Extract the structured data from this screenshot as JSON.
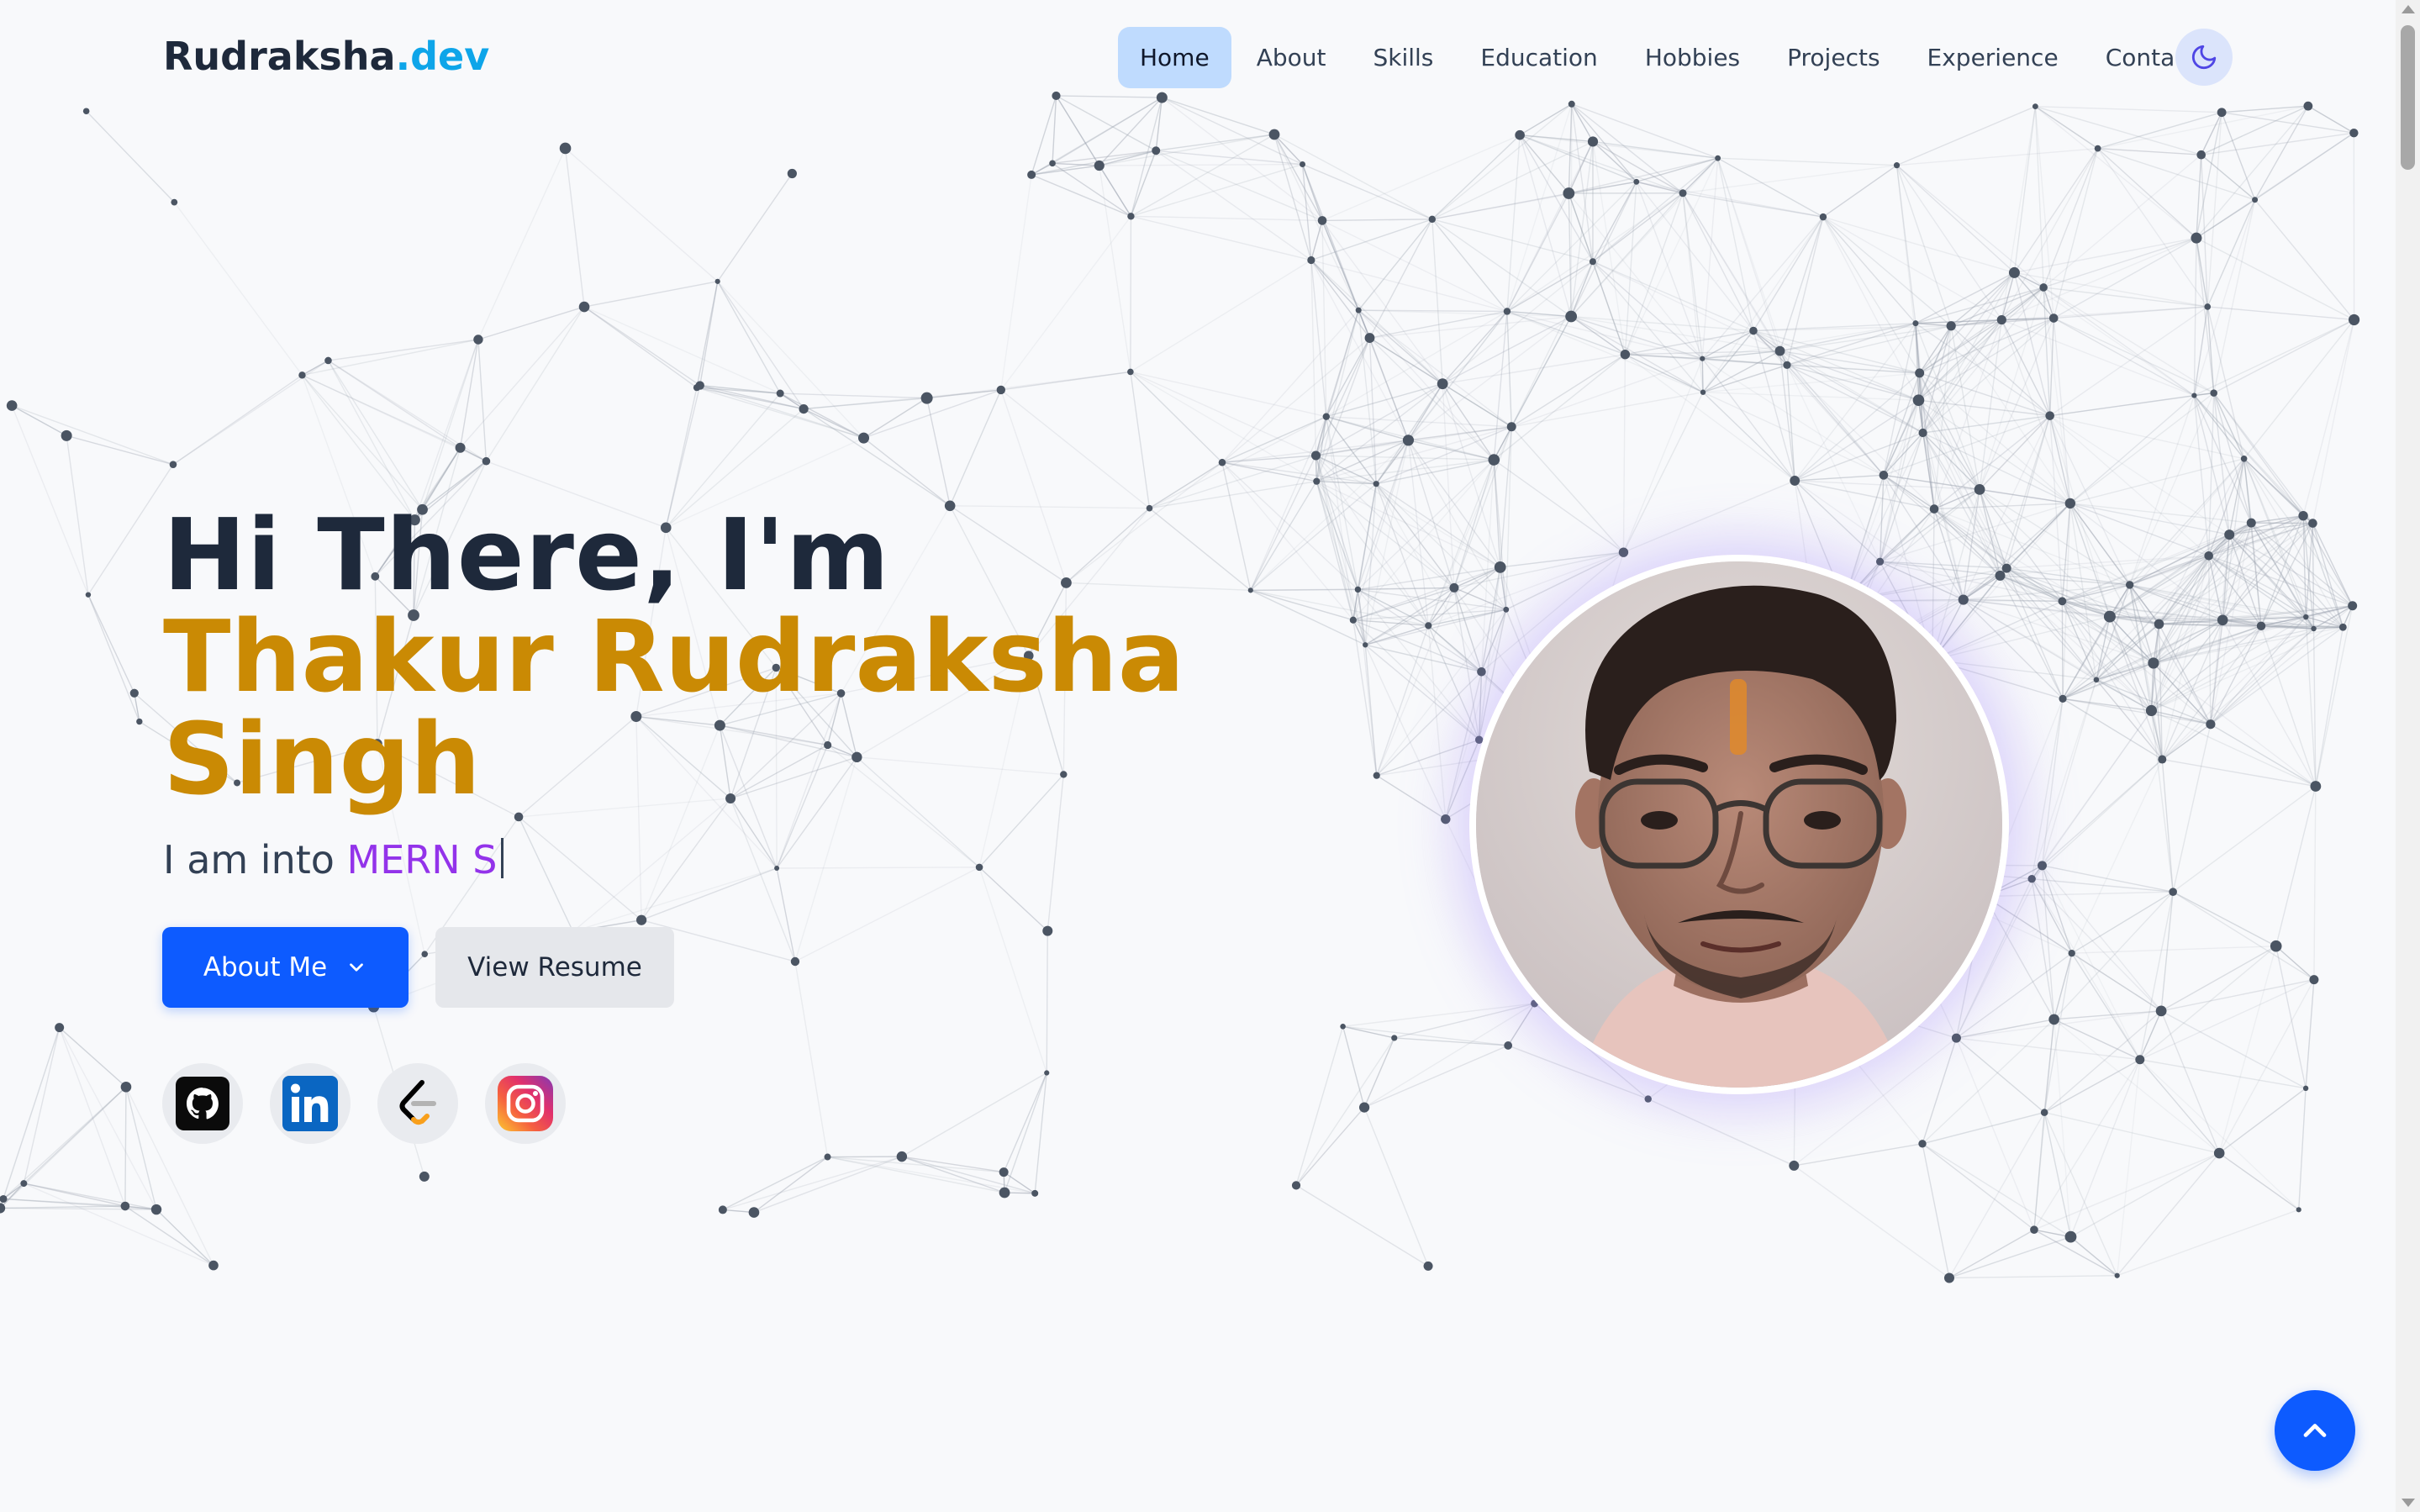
{
  "brand": {
    "name": "Rudraksha",
    "suffix": ".dev"
  },
  "nav": {
    "items": [
      {
        "label": "Home",
        "active": true
      },
      {
        "label": "About"
      },
      {
        "label": "Skills"
      },
      {
        "label": "Education"
      },
      {
        "label": "Hobbies"
      },
      {
        "label": "Projects"
      },
      {
        "label": "Experience"
      },
      {
        "label": "Contact"
      }
    ],
    "theme_toggle_icon": "moon-icon"
  },
  "hero": {
    "greeting": "Hi There, I'm",
    "name": "Thakur Rudraksha Singh",
    "typed_prefix": "I am into ",
    "typed_text": "MERN S",
    "about_button": "About Me",
    "resume_button": "View Resume"
  },
  "socials": [
    {
      "name": "github-icon"
    },
    {
      "name": "linkedin-icon"
    },
    {
      "name": "leetcode-icon"
    },
    {
      "name": "instagram-icon"
    }
  ],
  "colors": {
    "accent_blue": "#0d5bff",
    "name_gold": "#ca8a04",
    "typed_purple": "#9333ea",
    "brand_suffix": "#0ea5e9"
  }
}
